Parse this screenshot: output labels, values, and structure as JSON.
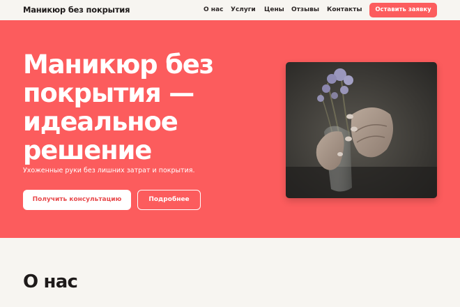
{
  "header": {
    "brand": "Маникюр без покрытия",
    "nav": [
      "О нас",
      "Услуги",
      "Цены",
      "Отзывы",
      "Контакты"
    ],
    "cta_label": "Оставить заявку"
  },
  "hero": {
    "title": "Маникюр без покрытия — идеальное решение",
    "subtitle": "Ухоженные руки без лишних затрат и покрытия.",
    "primary_button": "Получить консультацию",
    "secondary_button": "Подробнее"
  },
  "about": {
    "title": "О нас"
  },
  "colors": {
    "accent": "#fc5c5d",
    "background": "#f7f5f1",
    "text": "#1e1a1a"
  }
}
